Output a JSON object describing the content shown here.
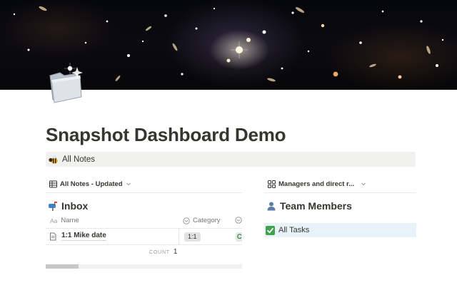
{
  "page": {
    "title": "Snapshot Dashboard Demo",
    "cover": "deep-field-galaxy-image",
    "icon": "folder-icon"
  },
  "link": {
    "emoji": "bee-icon",
    "label": "All Notes"
  },
  "left": {
    "view_label": "All Notes - Updated",
    "view_icon": "table-icon",
    "section_emoji": "mailbox-icon",
    "section_title": "Inbox",
    "columns": {
      "name_prefix": "Aa",
      "name": "Name",
      "category": "Category"
    },
    "rows": [
      {
        "name": "1:1 Mike date",
        "category": "1:1",
        "extra": "C"
      }
    ],
    "count_label": "COUNT",
    "count_value": "1"
  },
  "right": {
    "view_label": "Managers and direct r...",
    "view_icon": "gallery-icon",
    "section_emoji": "person-icon",
    "section_title": "Team Members",
    "tasks_emoji": "checkmark-icon",
    "tasks_label": "All Tasks"
  },
  "colors": {
    "text": "#37352f",
    "muted": "#787774",
    "callout_bg": "#f1f1ef",
    "tasks_bg": "#e7f3f8",
    "tag_gray": "#e3e2e0",
    "tag_green": "#dbeddb"
  }
}
